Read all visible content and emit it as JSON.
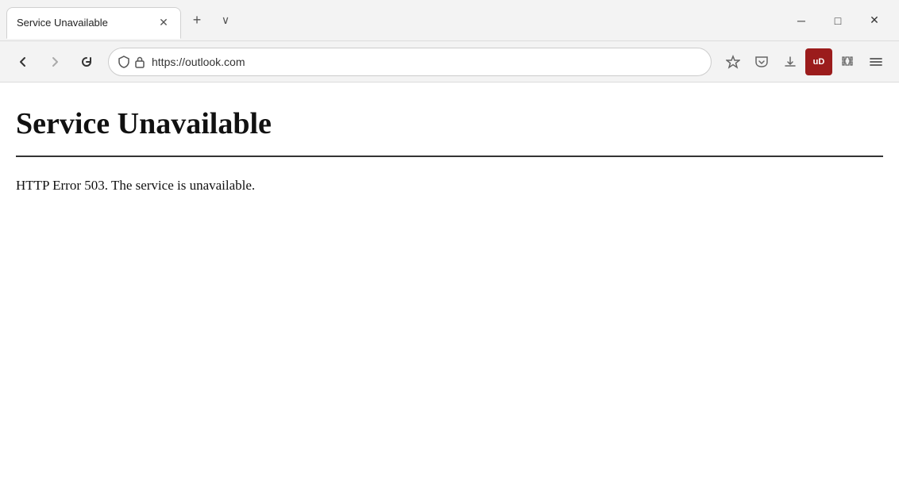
{
  "titlebar": {
    "tab_title": "Service Unavailable",
    "tab_close_label": "✕",
    "new_tab_label": "+",
    "tab_dropdown_label": "∨",
    "minimize_label": "─",
    "maximize_label": "□",
    "close_label": "✕"
  },
  "navbar": {
    "back_label": "←",
    "forward_label": "→",
    "refresh_label": "↻",
    "address": "https://outlook.com",
    "bookmark_label": "☆",
    "pocket_label": "⊕",
    "download_label": "⬇",
    "ublock_label": "uD",
    "extension_label": "🧩",
    "menu_label": "≡"
  },
  "page": {
    "heading": "Service Unavailable",
    "body": "HTTP Error 503. The service is unavailable."
  }
}
